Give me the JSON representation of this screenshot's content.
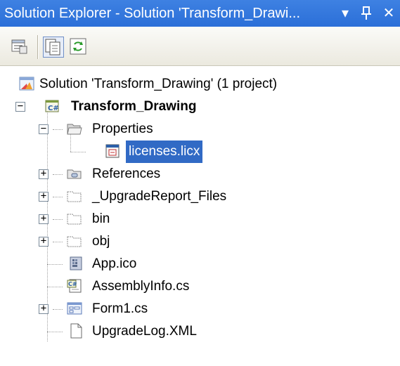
{
  "window": {
    "title": "Solution Explorer - Solution 'Transform_Drawi...",
    "dropdown_glyph": "▾",
    "pin_glyph": "↕",
    "close_glyph": "✕"
  },
  "toolbar": {
    "buttons": [
      {
        "icon": "properties-icon"
      },
      {
        "icon": "show-all-files-icon"
      },
      {
        "icon": "refresh-icon"
      }
    ]
  },
  "tree": {
    "solution": "Solution 'Transform_Drawing' (1 project)",
    "project": "Transform_Drawing",
    "items": [
      {
        "label": "Properties",
        "icon": "open-folder-icon",
        "expander": "−"
      },
      {
        "label": "licenses.licx",
        "icon": "licx-file-icon",
        "selected": true
      },
      {
        "label": "References",
        "icon": "references-icon",
        "expander": "+"
      },
      {
        "label": "_UpgradeReport_Files",
        "icon": "folder-icon",
        "expander": "+"
      },
      {
        "label": "bin",
        "icon": "folder-icon",
        "expander": "+"
      },
      {
        "label": "obj",
        "icon": "folder-icon",
        "expander": "+"
      },
      {
        "label": "App.ico",
        "icon": "icon-file-icon"
      },
      {
        "label": "AssemblyInfo.cs",
        "icon": "csharp-file-icon"
      },
      {
        "label": "Form1.cs",
        "icon": "form-icon",
        "expander": "+"
      },
      {
        "label": "UpgradeLog.XML",
        "icon": "document-icon"
      }
    ]
  },
  "colors": {
    "title_bar": "#2b6fd8",
    "selection": "#316ac5"
  }
}
